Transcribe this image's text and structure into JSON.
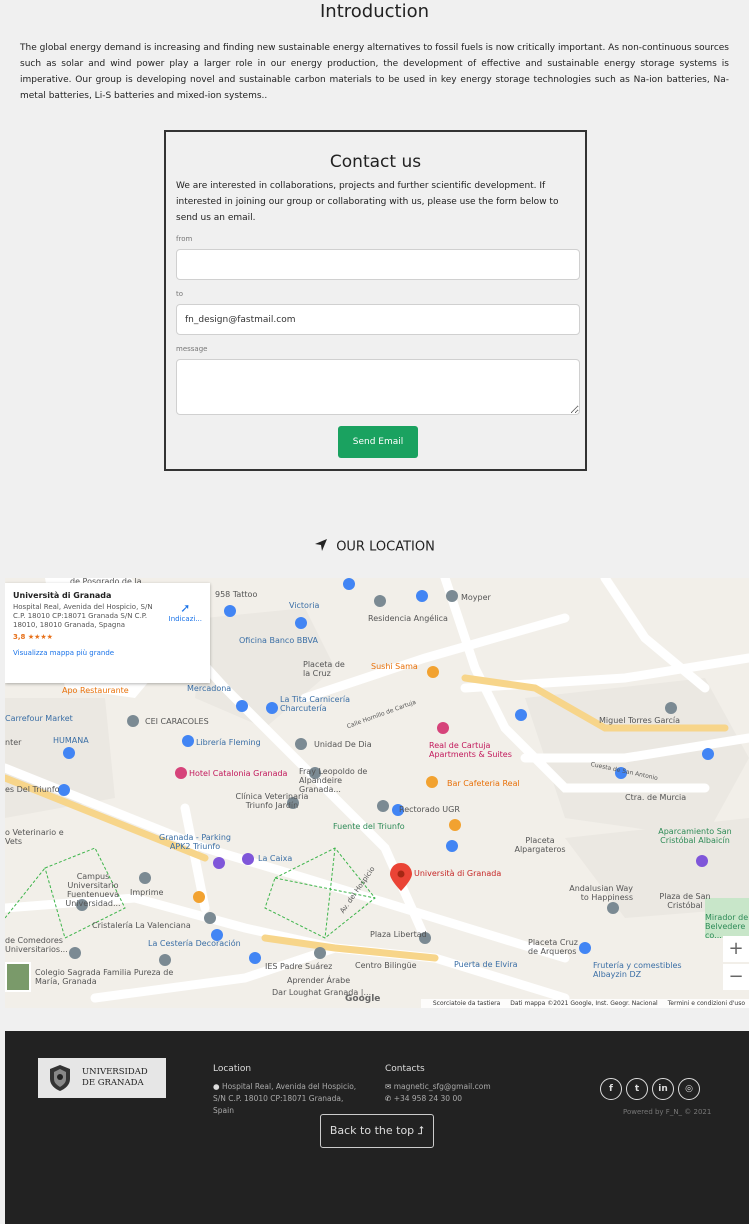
{
  "intro": {
    "title": "Introduction",
    "text": "The global energy demand is increasing and finding new sustainable energy alternatives to fossil fuels is now critically important. As non-continuous sources such as solar and wind power play a larger role in our energy production, the development of effective and sustainable energy storage systems is imperative. Our group is developing novel and sustainable carbon materials to be used in key energy storage technologies such as Na-ion batteries, Na-metal batteries, Li-S batteries and mixed-ion systems.."
  },
  "contact": {
    "title": "Contact us",
    "description": "We are interested in collaborations, projects and further scientific development. If interested in joining our group or collaborating with us, please use the form below to send us an email.",
    "from_label": "from",
    "from_value": "",
    "to_label": "to",
    "to_value": "fn_design@fastmail.com",
    "message_label": "message",
    "message_value": "",
    "send_label": "Send Email",
    "send_color": "#1aa260"
  },
  "location": {
    "title": "OUR LOCATION",
    "icon": "location-arrow-icon"
  },
  "map": {
    "card": {
      "name": "Università di Granada",
      "address": "Hospital Real, Avenida del Hospicio, S/N C.P. 18010 CP:18071 Granada S/N C.P. 18010, 18010 Granada, Spagna",
      "rating": "3,8",
      "stars": "★★★★",
      "directions": "Indicazi...",
      "bigger_map": "Visualizza mappa più grande"
    },
    "labels": [
      "de Posgrado de la...",
      "958 Tattoo",
      "Victoria",
      "Moyper",
      "Residencia Angélica",
      "Oficina Banco BBVA",
      "Placeta de la Cruz",
      "Sushi Sama",
      "Apo Restaurante",
      "Mercadona",
      "La Tita Carnicería Charcutería",
      "Carrefour Market",
      "CEI CARACOLES",
      "HUMANA",
      "Librería Fleming",
      "Unidad De Dia",
      "Real de Cartuja Apartments & Suites",
      "Miguel Torres García",
      "Hotel Catalonia Granada",
      "Fray Leopoldo de Alpandeire Granada...",
      "Bar Cafeteria Real",
      "Ctra. de Murcia",
      "Clínica Veterinaria Triunfo Jardín",
      "Rectorado UGR",
      "Fuente del Triunfo",
      "Granada - Parking APK2 Triunfo",
      "La Caixa",
      "Placeta Alpargateros",
      "Aparcamiento San Cristóbal Albaicín",
      "Università di Granada",
      "Campus Universitario Fuentenueva Universidad...",
      "Imprime",
      "Andalusian Way to Happiness",
      "Plaza de San Cristóbal",
      "Cristalería La Valenciana",
      "La Cestería Decoración",
      "Plaza Libertad",
      "Placeta Cruz de Arqueros",
      "Mirador de Belvedere co...",
      "Colegio Sagrada Familia Pureza de María, Granada",
      "IES Padre Suárez",
      "Centro Bilingüe",
      "Puerta de Elvira",
      "Frutería y comestibles Albayzin DZ",
      "Aprender Árabe",
      "Dar Loughat Granada |...",
      "es Del Triunfo",
      "nter",
      "de Comedores Universitarios...",
      "Av. del Hospicio",
      "Calle Hornillo de Cartuja",
      "Cuesta de San Antonio",
      "o Veterinario e Vets"
    ],
    "google": "Google",
    "keyboard": "Scorciatoie da tastiera",
    "data": "Dati mappa ©2021 Google, Inst. Geogr. Nacional",
    "terms": "Termini e condizioni d'uso",
    "zoom_in": "+",
    "zoom_out": "−"
  },
  "footer": {
    "uni_name_1": "UNIVERSIDAD",
    "uni_name_2": "DE GRANADA",
    "location_title": "Location",
    "location_text": "Hospital Real, Avenida del Hospicio, S/N C.P. 18010 CP:18071 Granada, Spain",
    "contacts_title": "Contacts",
    "email": "magnetic_sfg@gmail.com",
    "phone": "+34 958 24 30 00",
    "social": [
      "facebook-icon",
      "twitter-icon",
      "linkedin-icon",
      "instagram-icon"
    ],
    "powered": "Powered by F_N_ © 2021",
    "back_to_top": "Back to the top ⮥"
  }
}
